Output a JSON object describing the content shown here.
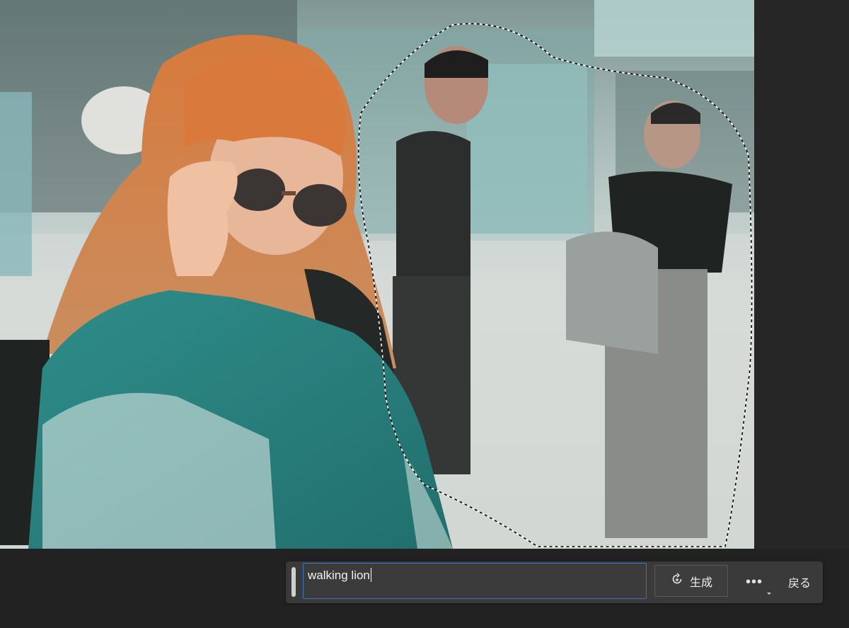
{
  "generative_bar": {
    "prompt_value": "walking lion",
    "generate_label": "生成",
    "more_label": "•••",
    "back_label": "戻る"
  },
  "icons": {
    "grip": "drag-handle-icon",
    "generate": "sparkle-refresh-icon",
    "more": "more-options-icon"
  },
  "colors": {
    "input_focus_border": "#3b73c7",
    "bar_background": "#3a3a3a",
    "app_background": "#232323"
  }
}
